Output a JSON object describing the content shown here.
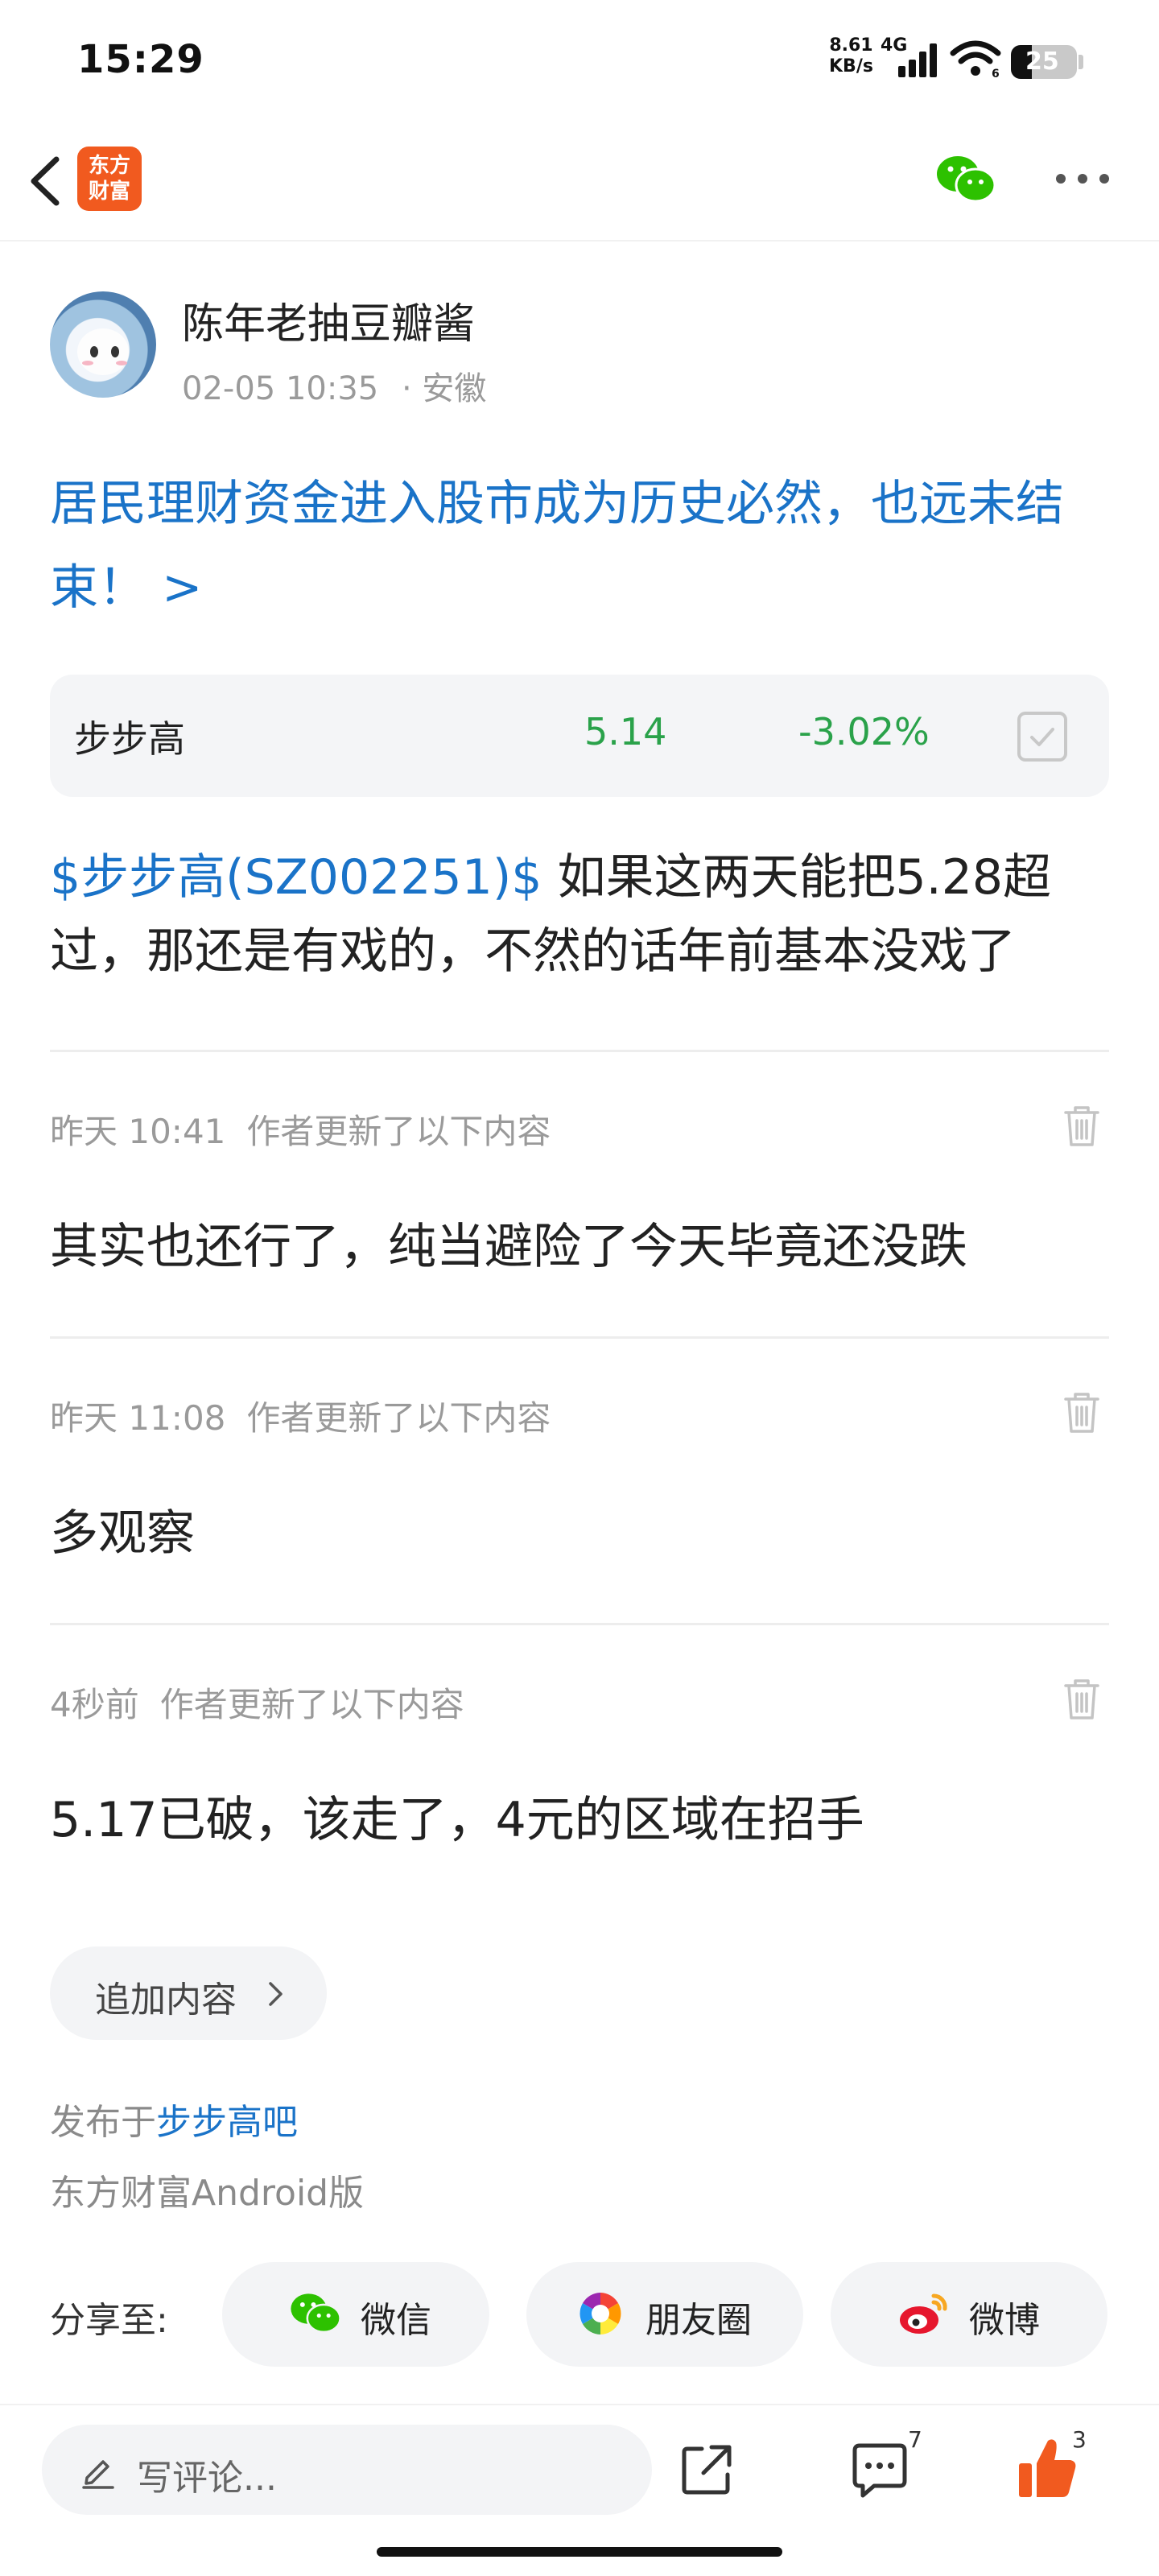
{
  "status_bar": {
    "time": "15:29",
    "net_speed_value": "8.61",
    "net_speed_unit": "KB/s",
    "net_type": "4G",
    "wifi_badge": "6",
    "battery_level": "25"
  },
  "nav": {
    "logo_line1": "东方",
    "logo_line2": "财富"
  },
  "author": {
    "name": "陈年老抽豆瓣酱",
    "datetime": "02-05 10:35",
    "location": "· 安徽"
  },
  "post": {
    "title": "居民理财资金进入股市成为历史必然，也远未结束！ >",
    "cashtag": "$步步高(SZ002251)$",
    "body": " 如果这两天能把5.28超过，那还是有戏的，不然的话年前基本没戏了"
  },
  "stock": {
    "name": "步步高",
    "price": "5.14",
    "change": "-3.02%"
  },
  "updates": [
    {
      "time": "昨天 10:41",
      "label": "作者更新了以下内容",
      "text": "其实也还行了，纯当避险了今天毕竟还没跌"
    },
    {
      "time": "昨天 11:08",
      "label": "作者更新了以下内容",
      "text": "多观察"
    },
    {
      "time": "4秒前",
      "label": "作者更新了以下内容",
      "text": "5.17已破，该走了，4元的区域在招手"
    }
  ],
  "add_content_label": "追加内容",
  "published": {
    "prefix": "发布于",
    "bar_name": "步步高吧",
    "client": "东方财富Android版"
  },
  "share": {
    "label": "分享至:",
    "wechat": "微信",
    "moments": "朋友圈",
    "weibo": "微博"
  },
  "bottom_bar": {
    "comment_placeholder": "写评论...",
    "comment_count": "7",
    "like_count": "3"
  },
  "colors": {
    "link_blue": "#1a73c8",
    "stock_green": "#2aa24a",
    "brand_orange": "#f15a1f",
    "like_orange": "#f15a1f",
    "wechat_green": "#2dc100"
  }
}
